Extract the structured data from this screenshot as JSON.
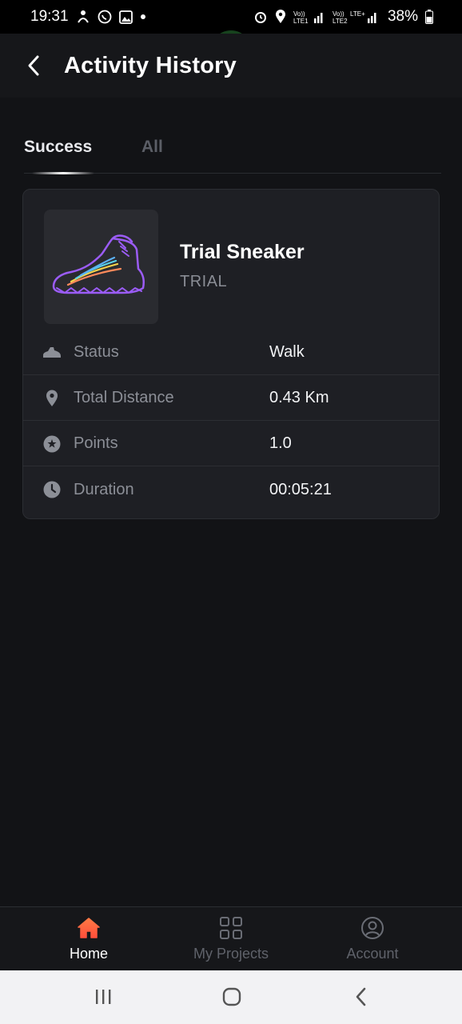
{
  "status_bar": {
    "time": "19:31",
    "battery": "38%",
    "icons": [
      "person-icon",
      "whatsapp-icon",
      "gallery-icon",
      "dot-icon",
      "alarm-icon",
      "location-icon",
      "volte1-signal-icon",
      "volte2-lte-signal-icon",
      "battery-icon"
    ]
  },
  "header": {
    "title": "Activity History",
    "back_icon": "chevron-left-icon"
  },
  "tabs": [
    {
      "label": "Success",
      "active": true
    },
    {
      "label": "All",
      "active": false
    }
  ],
  "activity": {
    "product_name": "Trial Sneaker",
    "product_type": "TRIAL",
    "rows": [
      {
        "icon": "sneaker-icon",
        "label": "Status",
        "value": "Walk"
      },
      {
        "icon": "location-pin-icon",
        "label": "Total Distance",
        "value": "0.43 Km"
      },
      {
        "icon": "points-icon",
        "label": "Points",
        "value": "1.0"
      },
      {
        "icon": "clock-icon",
        "label": "Duration",
        "value": "00:05:21"
      }
    ]
  },
  "bottom_nav": [
    {
      "label": "Home",
      "icon": "home-icon",
      "active": true
    },
    {
      "label": "My Projects",
      "icon": "grid-icon",
      "active": false
    },
    {
      "label": "Account",
      "icon": "account-icon",
      "active": false
    }
  ],
  "colors": {
    "background": "#121316",
    "card": "#1e1f24",
    "accent_home": "#ff6a3d",
    "sneaker_outline": "#9b5cf6"
  }
}
